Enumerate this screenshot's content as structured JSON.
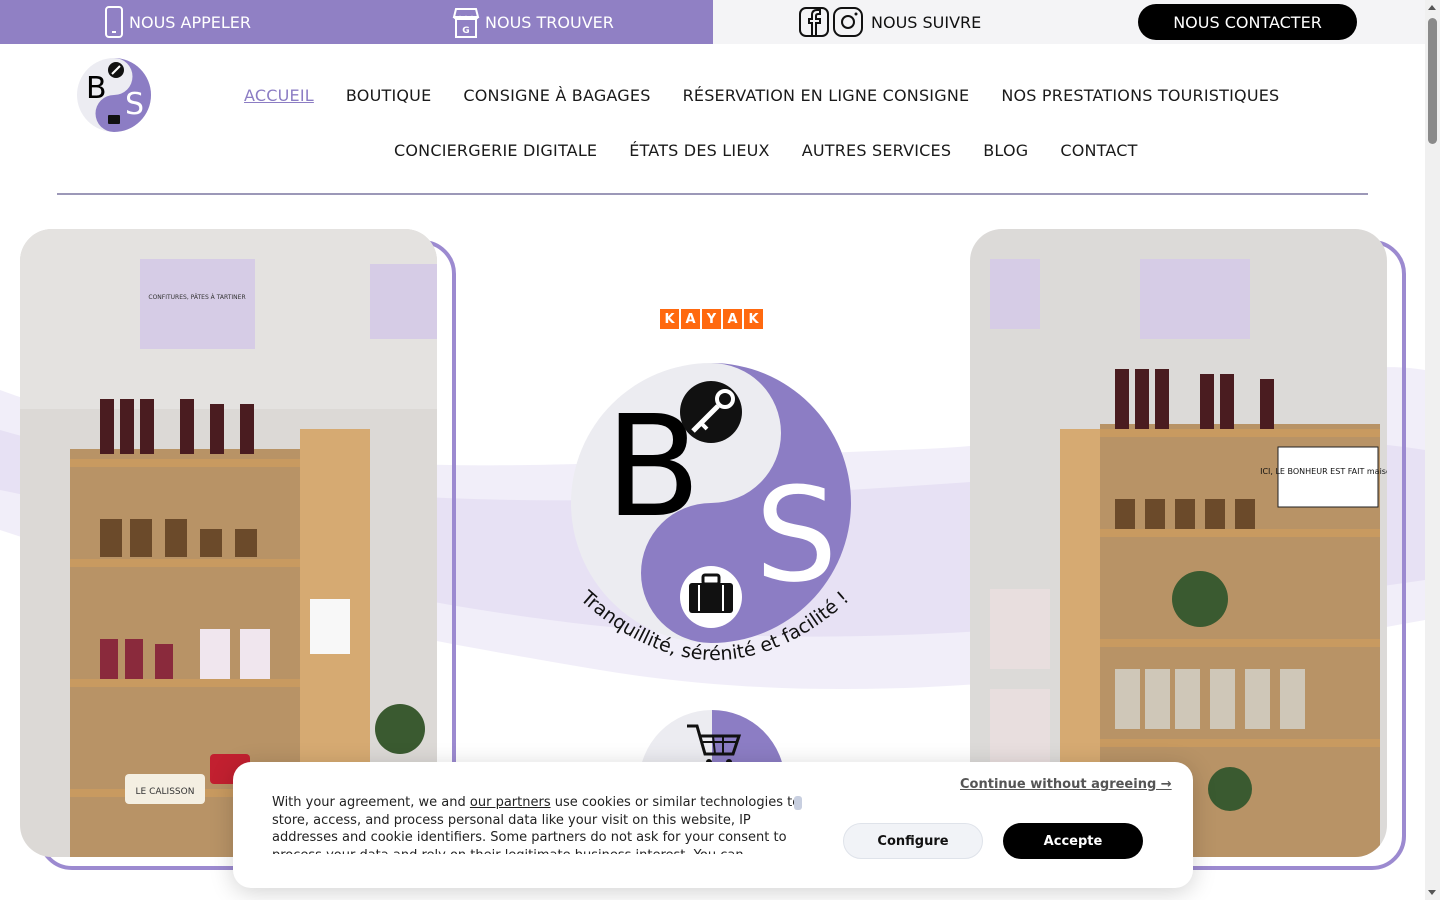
{
  "topbar": {
    "call_label": "NOUS APPELER",
    "find_label": "NOUS TROUVER",
    "follow_label": "NOUS SUIVRE",
    "contact_label": "NOUS CONTACTER",
    "accent_color": "#9080c4"
  },
  "nav": {
    "row1": [
      "ACCUEIL",
      "BOUTIQUE",
      "CONSIGNE À BAGAGES",
      "RÉSERVATION EN LIGNE CONSIGNE",
      "NOS PRESTATIONS TOURISTIQUES"
    ],
    "row2": [
      "CONCIERGERIE DIGITALE",
      "ÉTATS DES LIEUX",
      "AUTRES SERVICES",
      "BLOG",
      "CONTACT"
    ],
    "active": "ACCUEIL"
  },
  "hero": {
    "kayak_letters": [
      "K",
      "A",
      "Y",
      "A",
      "K"
    ],
    "logo_letters": [
      "B",
      "S"
    ],
    "tagline": "Tranquillité, sérénité et facilité !",
    "shelf_sign_left": "CONFITURES, PÂTES À TARTINER",
    "shelf_sign_right": "ICI, LE BONHEUR EST FAIT maison",
    "calisson_label": "LE CALISSON"
  },
  "cookie": {
    "text_before_link": "With your agreement, we and ",
    "link_text": "our partners",
    "text_after_link": " use cookies or similar technologies to store, access, and process personal data like your visit on this website, IP addresses and cookie identifiers. Some partners do not ask for your consent to process your data and rely on their legitimate business interest. You can",
    "continue_label": "Continue without agreeing →",
    "configure_label": "Configure",
    "accept_label": "Accepte"
  },
  "icons": {
    "phone": "phone-icon",
    "store": "store-icon",
    "facebook": "facebook-icon",
    "instagram": "instagram-icon",
    "key": "key-icon",
    "suitcase": "suitcase-icon",
    "cart": "cart-icon"
  }
}
